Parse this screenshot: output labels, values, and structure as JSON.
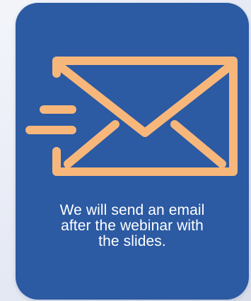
{
  "card": {
    "background_color": "#2c5aa3",
    "icon": "email-send-icon",
    "icon_color": "#f7b77b",
    "caption_lines": [
      "We will send an email",
      "after the webinar with",
      "the slides."
    ]
  }
}
